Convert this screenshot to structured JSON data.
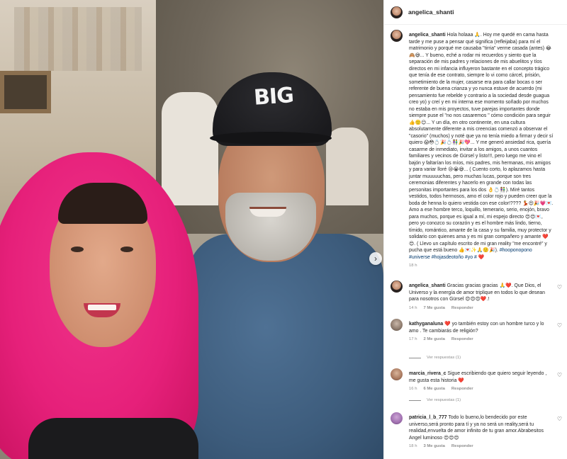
{
  "post": {
    "username": "angelica_shanti",
    "cap_text": "BIG",
    "caption_user": "angelica_shanti",
    "caption_text": "Hola holaaa 🙏. Hoy me quedé en cama hasta tarde y me puse a pensar qué significa (refleijaba) para mí el matrimonio y porqué me causaba \"tirria\" verme casada (antes) 😂🙈😅... Y bueno, eché a rodar mi recuerdos y siento que la separación de mis padres y relaciones de mis abuelitos y tíos directos en mi infancia influyeron bastante en el concepto trágico que tenía de ese contrato, siempre lo vi como cárcel, prisión, sometimiento de la mujer, casarse era para callar bocas o ser referente de buena crianza y yo nunca estuve de acuerdo (mi pensamiento fue rebelde y contrario a la sociedad desde guagua creo yo) y creí y en mi interna ese momento soñado por muchos no estaba en mis proyectos, tuve parejas importantes donde siempre puse el \"no nos casaremos \" cómo condición para seguir 👍🙂😊... Y un día, en otro continente, en una cultura absolutamente diferente a mis creencias comenzó a observar el \"casorio\" (muchos) y noté que ya no tenía miedo a firmar y decir sí quiero 😱😳💍🎉💍👫🎉💖... Y me generó ansiedad rica, quería casarme de inmediato, invitar a los amigos, a unos cuantos familiares y vecinos de Gürsel y listo!!!, pero luego me vino el bajón y faltarían los míos, mis padres, mis hermanas, mis amigos y para variar lloré 😢😭😅... ( Cuento corto, lo aplazamos hasta juntar muuuuuchas, pero muchas lucas, porque son tres ceremonias diferentes y hacerlo en grande con todas las personitas importantes para los dos 👌💍👫). Miré tantos vestidos, todos hermosos, amo el color rojo y pueden creer que la boda de henna lo quiero vestida con ese color!???? 💃😍🎉💗💌. Amo a ese hombre terco, loquillo, temerario, serio, enojón, bravo para muchos, porque es igual a mí, mi espejo directo 😍😍💌, pero yo conozco su corazón y es el hombre más lindo, tierno, tímido, romántico, amante de la casa y su familia, muy protector y solidario con quienes ama y es mi gran compañero y amante ❤️😍. ( Llevo un capítulo escrito de mi gran reality \"me encontré\" y pucha que está bueno 👍💌✨🙏🙂🎉).",
    "caption_tags": "#hooponopono #universe #hojasdeotoño #yo #",
    "caption_tail": "❤️",
    "caption_time": "18 h"
  },
  "comments": [
    {
      "user": "angelica_shanti",
      "text": "Gracias gracias gracias 🙏❤️. Que Dios, el Universo y la energía de amor triplique en todos lo que desean para nosotros con Gürsel 😍😍😍❤️.!",
      "time": "14 h",
      "likes": "7 Me gusta",
      "reply": "Responder",
      "avatar": "avatar-angelica"
    },
    {
      "user": "kathyganaluna",
      "text": "❤️ yo también estoy con un hombre turco y lo amo . Te cambiarás de religión?",
      "time": "17 h",
      "likes": "2 Me gusta",
      "reply": "Responder",
      "avatar": "avatar-kathy",
      "replies": "Ver respuestas (1)"
    },
    {
      "user": "marcia_rivera_c",
      "text": "Sigue escribiendo que quiero seguir leyendo , me gusta esta historia ❤️",
      "time": "16 h",
      "likes": "6 Me gusta",
      "reply": "Responder",
      "avatar": "avatar-marcia",
      "replies": "Ver respuestas (1)"
    },
    {
      "user": "patricia_l_b_777",
      "text": "Todo lo bueno,lo bendecido por este universo,será pronto para tí y ya no será un reality,será tu realidad,envuelta de amor infinito de tu gran amor.Abrabesitos Angel luminoso 😍😍😍",
      "time": "18 h",
      "likes": "3 Me gusta",
      "reply": "Responder",
      "avatar": "avatar-patricia"
    }
  ],
  "icons": {
    "like": "heart-outline-icon",
    "next": "chevron-right-icon"
  }
}
